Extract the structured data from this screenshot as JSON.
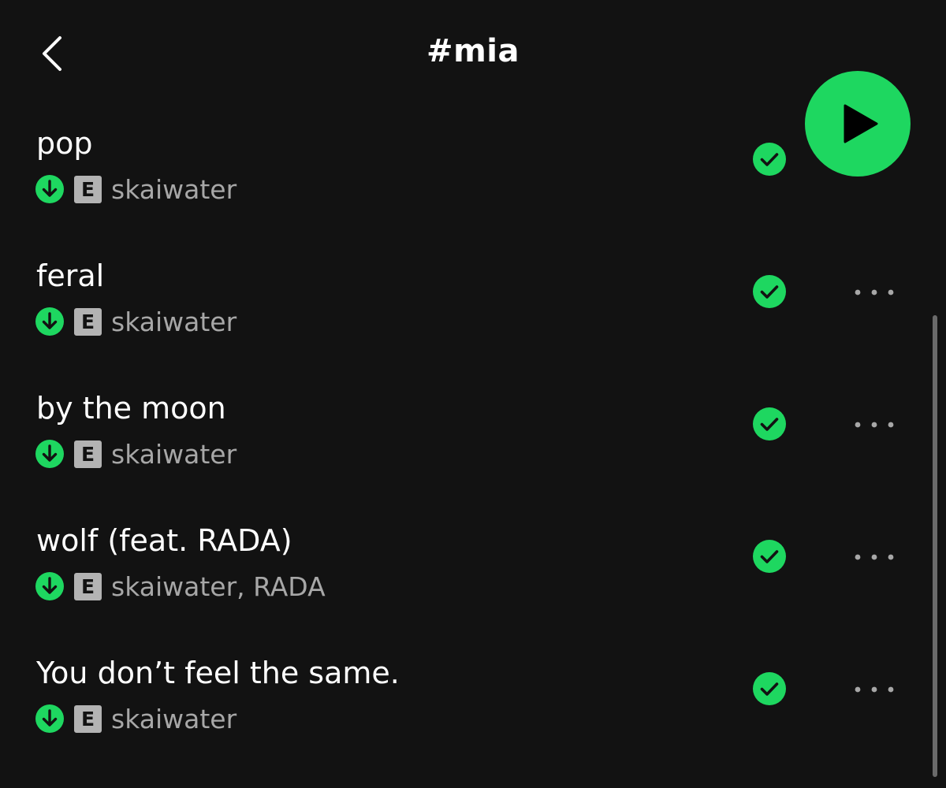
{
  "header": {
    "back_icon": "chevron-left-icon",
    "title": "#mia",
    "play_icon": "play-icon"
  },
  "colors": {
    "background": "#121212",
    "accent": "#1ed760",
    "secondary_text": "#a7a7a7",
    "badge": "#b3b3b3"
  },
  "tracks": [
    {
      "title": "pop",
      "artists": "skaiwater",
      "explicit": "E",
      "downloaded": true,
      "liked": true
    },
    {
      "title": "feral",
      "artists": "skaiwater",
      "explicit": "E",
      "downloaded": true,
      "liked": true
    },
    {
      "title": "by the moon",
      "artists": "skaiwater",
      "explicit": "E",
      "downloaded": true,
      "liked": true
    },
    {
      "title": "wolf (feat. RADA)",
      "artists": "skaiwater, RADA",
      "explicit": "E",
      "downloaded": true,
      "liked": true
    },
    {
      "title": "You don’t feel the same.",
      "artists": "skaiwater",
      "explicit": "E",
      "downloaded": true,
      "liked": true
    }
  ]
}
